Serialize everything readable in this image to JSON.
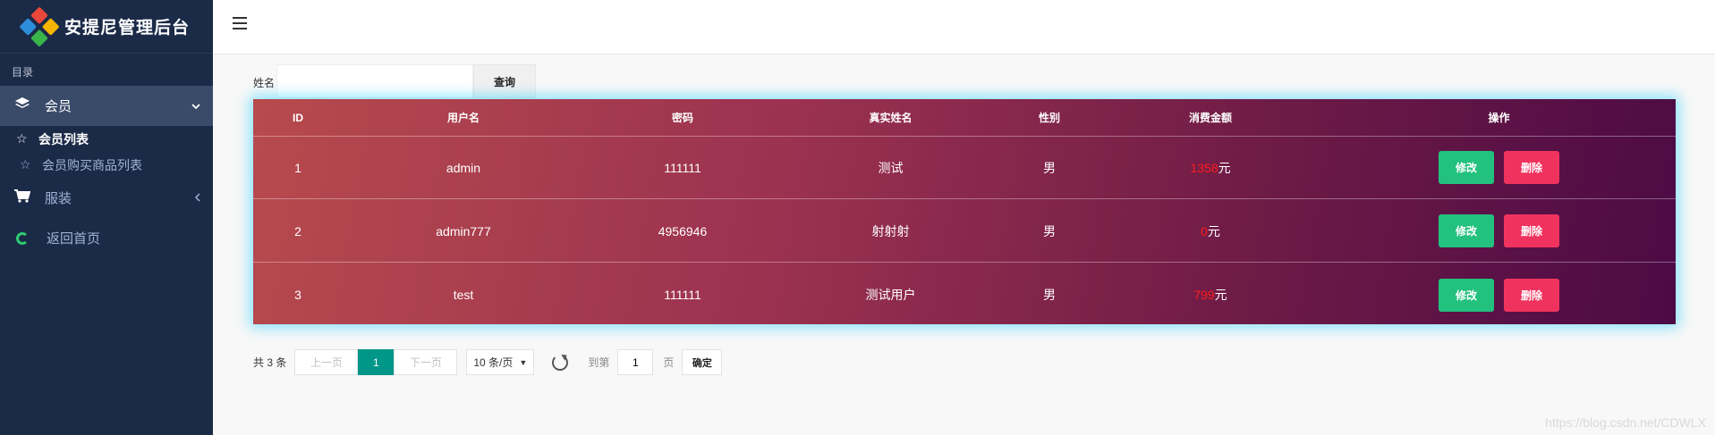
{
  "app": {
    "title": "安提尼管理后台"
  },
  "sidebar": {
    "caption": "目录",
    "items": [
      {
        "label": "会员",
        "icon": "layers-icon",
        "active": true
      },
      {
        "label": "会员列表",
        "icon": "star-icon"
      },
      {
        "label": "会员购买商品列表",
        "icon": "star-outline-icon"
      },
      {
        "label": "服装",
        "icon": "cart-icon"
      },
      {
        "label": "返回首页",
        "icon": "ring-icon"
      }
    ]
  },
  "search": {
    "label": "姓名",
    "value": "",
    "placeholder": "",
    "button": "查询"
  },
  "table": {
    "headers": [
      "ID",
      "用户名",
      "密码",
      "真实姓名",
      "性别",
      "消费金额",
      "操作"
    ],
    "rows": [
      {
        "id": "1",
        "username": "admin",
        "password": "111111",
        "realname": "测试",
        "sex": "男",
        "amount": "1358",
        "unit": "元"
      },
      {
        "id": "2",
        "username": "admin777",
        "password": "4956946",
        "realname": "射射射",
        "sex": "男",
        "amount": "0",
        "unit": "元"
      },
      {
        "id": "3",
        "username": "test",
        "password": "111111",
        "realname": "测试用户",
        "sex": "男",
        "amount": "799",
        "unit": "元"
      }
    ],
    "edit_label": "修改",
    "delete_label": "删除"
  },
  "pager": {
    "count_text": "共 3 条",
    "prev": "上一页",
    "current": "1",
    "next": "下一页",
    "page_size": "10 条/页",
    "goto_label": "到第",
    "goto_value": "1",
    "page_unit": "页",
    "confirm": "确定"
  },
  "watermark": "https://blog.csdn.net/CDWLX",
  "colors": {
    "sidebar": "#1b2a47",
    "edit": "#23c17e",
    "delete": "#f0335e",
    "pager_active": "#009688",
    "amount": "#ff1a1a"
  }
}
